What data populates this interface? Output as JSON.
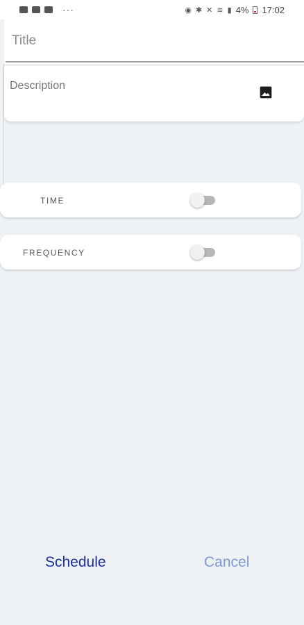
{
  "status_bar": {
    "dots": "···",
    "battery": "4%",
    "time": "17:02",
    "icons": [
      "gallery-icon",
      "youtube-icon",
      "youtube-icon",
      "alarm-icon",
      "bluetooth-icon",
      "mute-icon",
      "wifi-icon",
      "signal-icon",
      "battery-icon"
    ]
  },
  "form": {
    "title_placeholder": "Title",
    "description_placeholder": "Description",
    "description_icon": "image-icon"
  },
  "options": {
    "time_label": "TIME",
    "time_enabled": false,
    "frequency_label": "FREQUENCY",
    "frequency_enabled": false
  },
  "actions": {
    "schedule_label": "Schedule",
    "cancel_label": "Cancel"
  },
  "colors": {
    "background": "#eef2f5",
    "schedule": "#1a2fa0",
    "cancel": "#7f96d6"
  }
}
